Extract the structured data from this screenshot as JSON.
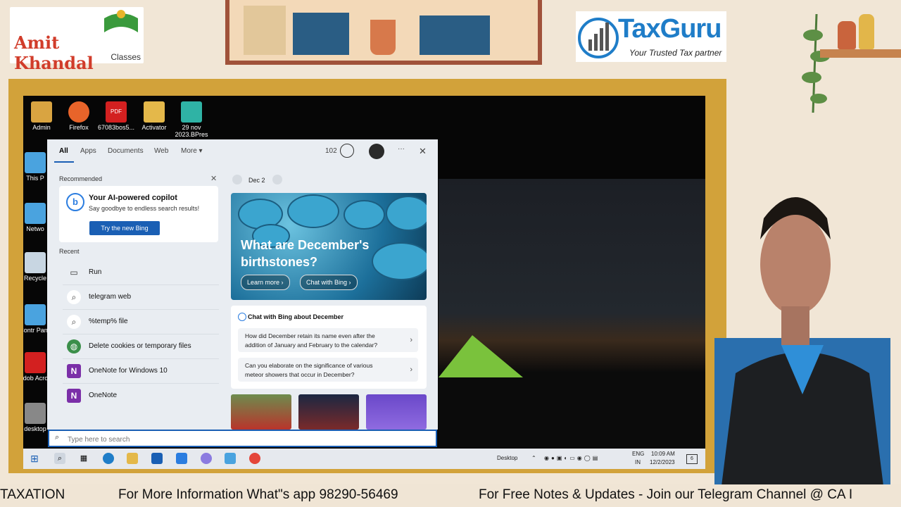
{
  "branding": {
    "left_logo_main": "Amit Khandal",
    "left_logo_sub": "Classes",
    "right_logo_main": "TaxGuru",
    "right_logo_sub": "Your Trusted Tax partner"
  },
  "desktop_icons": [
    {
      "label": "Admin",
      "color": "#d9a441"
    },
    {
      "label": "Firefox",
      "color": "#e8642a"
    },
    {
      "label": "67083bos5...",
      "color": "#d32020"
    },
    {
      "label": "Activator",
      "color": "#e4b84a"
    },
    {
      "label": "29 nov 2023.BPres",
      "color": "#2fb3a5"
    }
  ],
  "desktop_side_icons": [
    {
      "label": "This P"
    },
    {
      "label": "Netwo"
    },
    {
      "label": "Recycle"
    },
    {
      "label": "Contr Pane"
    },
    {
      "label": "Adob Acrob"
    },
    {
      "label": "desktop"
    }
  ],
  "search_panel": {
    "tabs": [
      "All",
      "Apps",
      "Documents",
      "Web",
      "More ▾"
    ],
    "points": "102",
    "more_dots": "···",
    "close": "✕",
    "recommended_title": "Recommended",
    "copilot": {
      "title": "Your AI-powered copilot",
      "subtitle": "Say goodbye to endless search results!",
      "button": "Try the new Bing"
    },
    "recent_title": "Recent",
    "recent": [
      {
        "label": "Run",
        "icon": "run-icon",
        "glyph": "▭"
      },
      {
        "label": "telegram web",
        "icon": "search-icon",
        "glyph": "⌕"
      },
      {
        "label": "%temp% file",
        "icon": "search-icon",
        "glyph": "⌕"
      },
      {
        "label": "Delete cookies or temporary files",
        "icon": "globe-settings-icon",
        "glyph": "◍"
      },
      {
        "label": "OneNote for Windows 10",
        "icon": "onenote-icon",
        "glyph": "N"
      },
      {
        "label": "OneNote",
        "icon": "onenote-icon",
        "glyph": "N"
      }
    ],
    "date": "Dec 2",
    "hero": {
      "title": "What are December's birthstones?",
      "learn_more": "Learn more ›",
      "chat": "Chat with Bing ›"
    },
    "chat_card": {
      "title": "Chat with Bing about December",
      "questions": [
        "How did December retain its name even after the addition of January and February to the calendar?",
        "Can you elaborate on the significance of various meteor showers that occur in December?"
      ]
    },
    "search_placeholder": "Type here to search"
  },
  "taskbar": {
    "desktop_label": "Desktop",
    "lang1": "ENG",
    "lang2": "IN",
    "time": "10:09 AM",
    "date": "12/2/2023",
    "notif_count": "6"
  },
  "ticker": {
    "part1": "TAXATION",
    "part2": "For More Information What\"s app 98290-56469",
    "part3": "For Free Notes & Updates - Join our Telegram Channel @ CA I"
  },
  "colors": {
    "accent": "#1a5fb4",
    "frame": "#d2a23a",
    "background": "#f1e6d6"
  }
}
